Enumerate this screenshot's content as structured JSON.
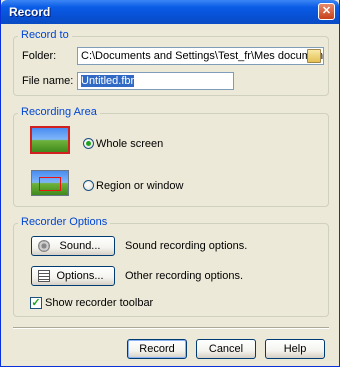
{
  "window": {
    "title": "Record",
    "close_glyph": "✕"
  },
  "record_to": {
    "title": "Record to",
    "folder_label": "Folder:",
    "folder_value": "C:\\Documents and Settings\\Test_fr\\Mes documents\\BB Fla",
    "filename_label": "File name:",
    "filename_value": "Untitled.fbr"
  },
  "recording_area": {
    "title": "Recording Area",
    "options": [
      {
        "label": "Whole screen",
        "selected": true
      },
      {
        "label": "Region or window",
        "selected": false
      }
    ]
  },
  "recorder_options": {
    "title": "Recorder Options",
    "sound_button": "Sound...",
    "sound_desc": "Sound recording options.",
    "options_button": "Options...",
    "options_desc": "Other recording options.",
    "toolbar_checkbox_label": "Show recorder toolbar",
    "toolbar_checked": true,
    "check_glyph": "✓"
  },
  "footer": {
    "record_button": "Record",
    "cancel_button": "Cancel",
    "help_button": "Help"
  }
}
